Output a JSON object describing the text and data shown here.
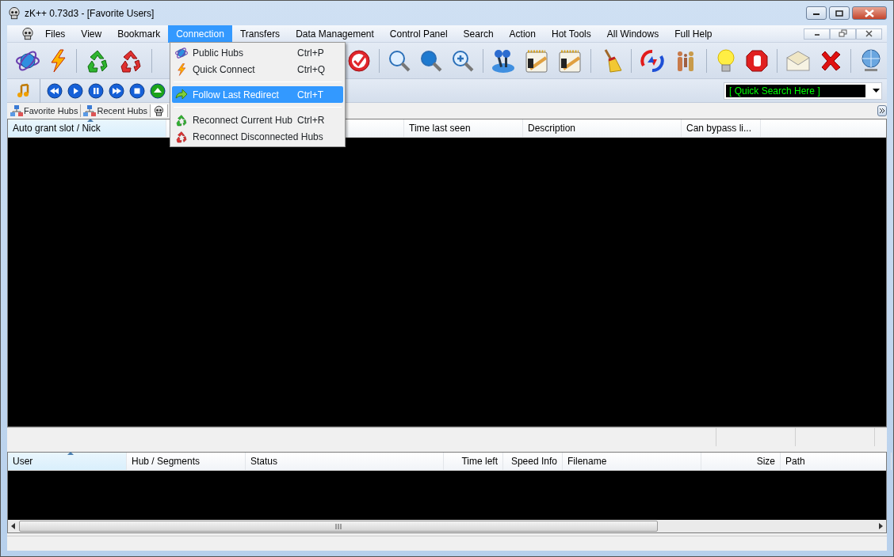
{
  "window": {
    "title": "zK++ 0.73d3  - [Favorite Users]"
  },
  "menu": [
    {
      "label": "Files",
      "selected": false
    },
    {
      "label": "View",
      "selected": false
    },
    {
      "label": "Bookmark",
      "selected": false
    },
    {
      "label": "Connection",
      "selected": true
    },
    {
      "label": "Transfers",
      "selected": false
    },
    {
      "label": "Data Management",
      "selected": false
    },
    {
      "label": "Control Panel",
      "selected": false
    },
    {
      "label": "Search",
      "selected": false
    },
    {
      "label": "Action",
      "selected": false
    },
    {
      "label": "Hot Tools",
      "selected": false
    },
    {
      "label": "All Windows",
      "selected": false
    },
    {
      "label": "Full Help",
      "selected": false
    }
  ],
  "dropdown": [
    {
      "kind": "item",
      "label": "Public Hubs",
      "shortcut": "Ctrl+P",
      "selected": false
    },
    {
      "kind": "item",
      "label": "Quick Connect",
      "shortcut": "Ctrl+Q",
      "selected": false
    },
    {
      "kind": "separator"
    },
    {
      "kind": "item",
      "label": "Follow Last Redirect",
      "shortcut": "Ctrl+T",
      "selected": true
    },
    {
      "kind": "separator"
    },
    {
      "kind": "item",
      "label": "Reconnect Current Hub",
      "shortcut": "Ctrl+R",
      "selected": false
    },
    {
      "kind": "item",
      "label": "Reconnect Disconnected Hubs",
      "selected": false
    }
  ],
  "quick_search": {
    "value": "[ Quick Search Here ]"
  },
  "tabs": [
    {
      "label": "Favorite Hubs",
      "selected": false
    },
    {
      "label": "Recent Hubs",
      "selected": false
    }
  ],
  "users_table": {
    "columns": [
      {
        "label": "Auto grant slot / Nick",
        "sorted": true
      },
      {
        "label": "Time last seen",
        "sorted": false
      },
      {
        "label": "Description",
        "sorted": false
      },
      {
        "label": "Can bypass li...",
        "sorted": false
      }
    ]
  },
  "transfers_table": {
    "columns": [
      {
        "label": "User",
        "sorted": true
      },
      {
        "label": "Hub / Segments",
        "sorted": false
      },
      {
        "label": "Status",
        "sorted": false
      },
      {
        "label": "Time left",
        "sorted": false
      },
      {
        "label": "Speed Info",
        "sorted": false
      },
      {
        "label": "Filename",
        "sorted": false
      },
      {
        "label": "Size",
        "sorted": false
      },
      {
        "label": "Path",
        "sorted": false
      }
    ]
  }
}
